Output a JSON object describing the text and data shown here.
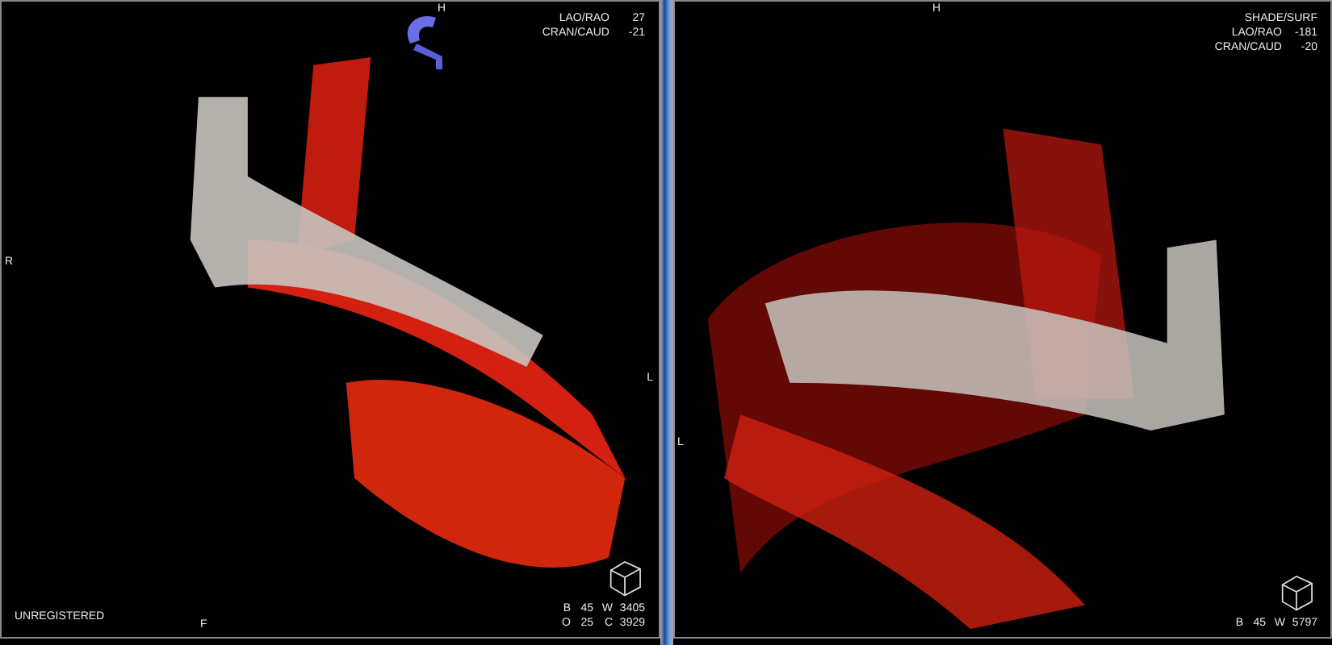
{
  "viewports": [
    {
      "orientation_markers": {
        "top": "H",
        "left": "R",
        "right": "L",
        "bottom": "F"
      },
      "info": [
        {
          "label": "LAO/RAO",
          "value": "27"
        },
        {
          "label": "CRAN/CAUD",
          "value": "-21"
        }
      ],
      "status": "UNREGISTERED",
      "window_stats": [
        [
          "B",
          "45",
          "W",
          "3405"
        ],
        [
          "O",
          "25",
          "C",
          "3929"
        ]
      ]
    },
    {
      "orientation_markers": {
        "top": "H",
        "left": "L"
      },
      "info": [
        {
          "label": "LAO/RAO",
          "value": "-181"
        },
        {
          "label": "CRAN/CAUD",
          "value": "-20"
        }
      ],
      "render_mode": "SHADE/SURF",
      "window_stats": [
        [
          "B",
          "45",
          "W",
          "5797"
        ]
      ]
    }
  ]
}
